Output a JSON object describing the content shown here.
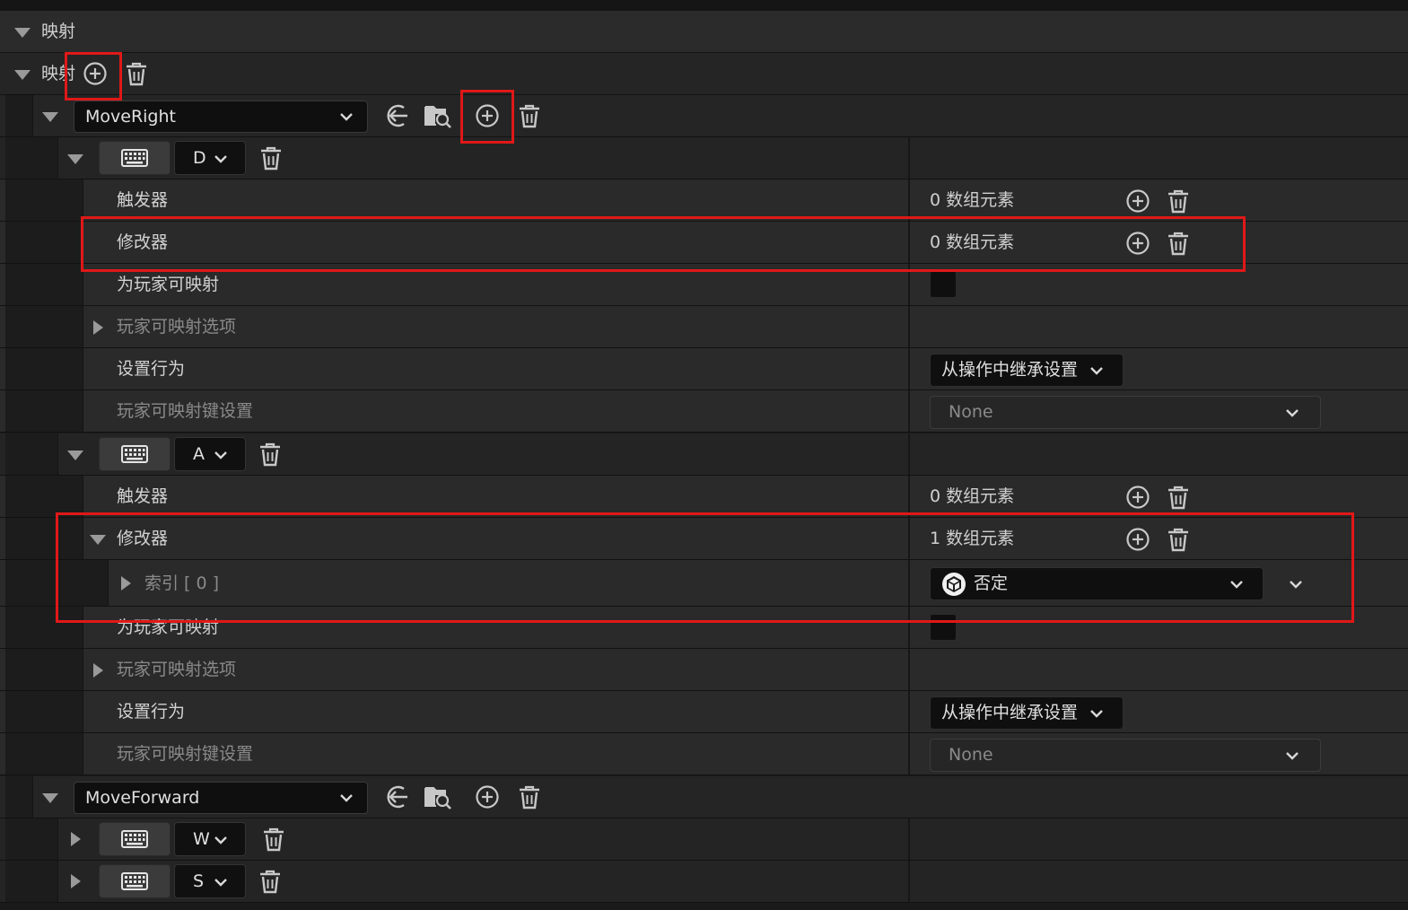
{
  "colors": {
    "highlight": "#e01818",
    "background": "#1a1a1a",
    "text": "#c8c8c8"
  },
  "section": {
    "title": "映射"
  },
  "mappings_header": {
    "label": "映射"
  },
  "actions": [
    {
      "name": "MoveRight",
      "keys": [
        {
          "key": "D",
          "properties": {
            "triggers_label": "触发器",
            "triggers_value": "0 数组元素",
            "modifiers_label": "修改器",
            "modifiers_value": "0 数组元素",
            "player_mappable_label": "为玩家可映射",
            "player_mappable_options_label": "玩家可映射选项",
            "setting_behavior_label": "设置行为",
            "setting_behavior_value": "从操作中继承设置",
            "player_mappable_key_settings_label": "玩家可映射键设置",
            "player_mappable_key_settings_value": "None"
          }
        },
        {
          "key": "A",
          "properties": {
            "triggers_label": "触发器",
            "triggers_value": "0 数组元素",
            "modifiers_label": "修改器",
            "modifiers_value": "1 数组元素",
            "modifier_index_label": "索引 [ 0 ]",
            "modifier_index_value": "否定",
            "player_mappable_label": "为玩家可映射",
            "player_mappable_options_label": "玩家可映射选项",
            "setting_behavior_label": "设置行为",
            "setting_behavior_value": "从操作中继承设置",
            "player_mappable_key_settings_label": "玩家可映射键设置",
            "player_mappable_key_settings_value": "None"
          }
        }
      ]
    },
    {
      "name": "MoveForward",
      "keys": [
        {
          "key": "W"
        },
        {
          "key": "S"
        }
      ]
    }
  ],
  "icons": [
    "expand-arrow-icon",
    "add-icon",
    "trash-icon",
    "back-arrow-icon",
    "browse-folder-icon",
    "keyboard-icon",
    "chevron-down-icon",
    "modifier-cube-icon"
  ]
}
